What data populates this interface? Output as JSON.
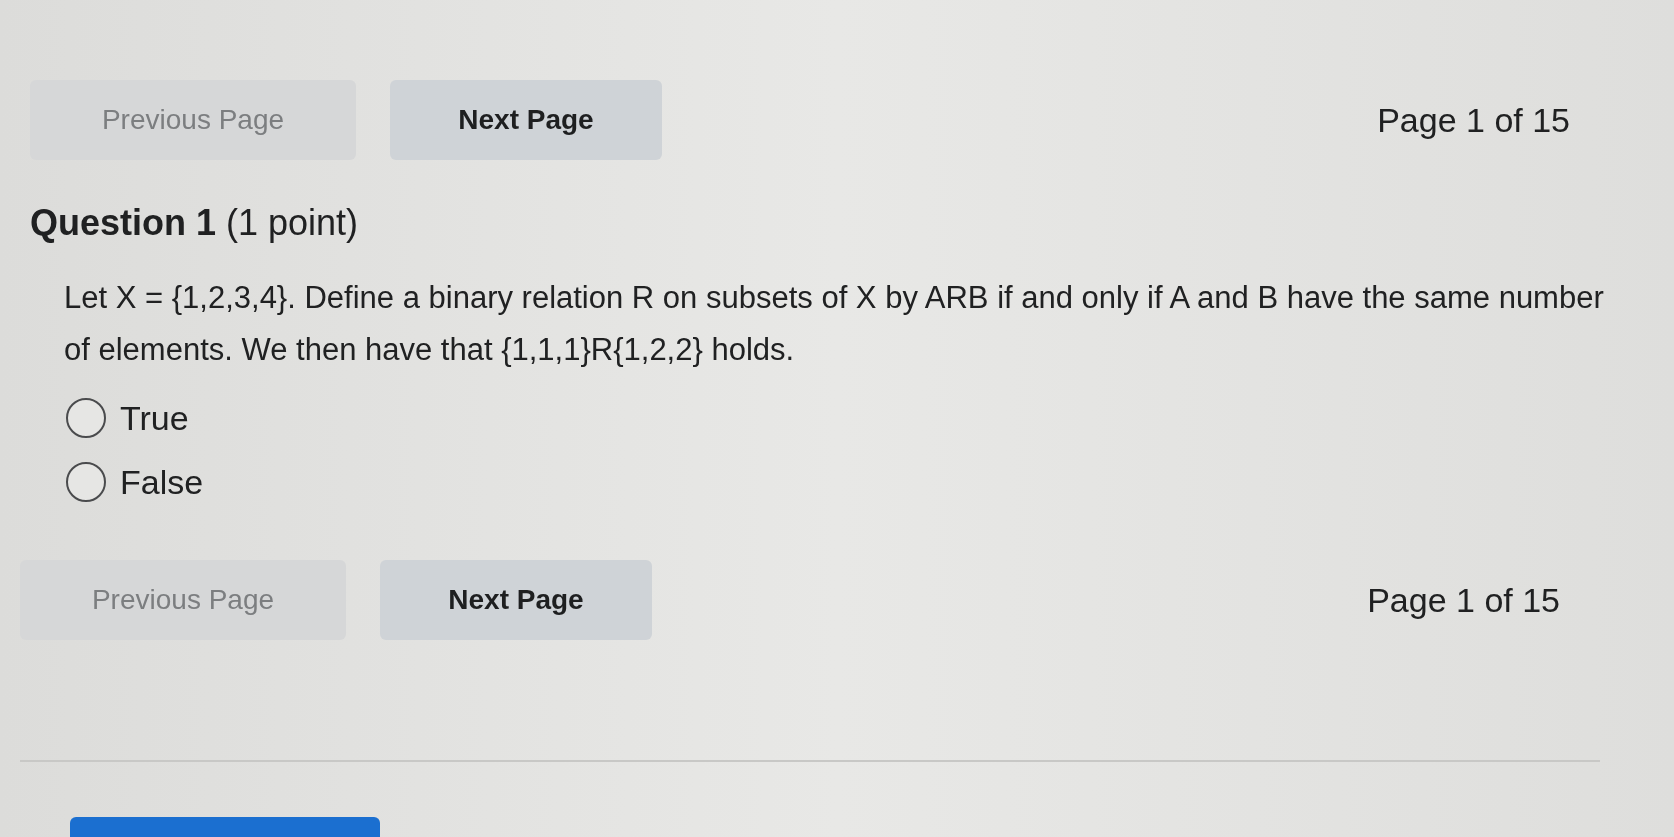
{
  "top_nav": {
    "buttons": [
      {
        "label": "Previous Page",
        "disabled": true
      },
      {
        "label": "Next Page",
        "disabled": false
      }
    ],
    "page_indicator": "Page 1 of 15"
  },
  "question": {
    "title": "Question 1",
    "points": "(1 point)",
    "text": "Let X = {1,2,3,4}. Define a binary relation R on subsets of X by ARB if and only if A and B have the same number of elements. We then have that {1,1,1}R{1,2,2} holds.",
    "options": [
      {
        "label": "True",
        "selected": false
      },
      {
        "label": "False",
        "selected": false
      }
    ]
  },
  "bottom_nav": {
    "buttons": [
      {
        "label": "Previous Page",
        "disabled": true
      },
      {
        "label": "Next Page",
        "disabled": false
      }
    ],
    "page_indicator": "Page 1 of 15"
  }
}
